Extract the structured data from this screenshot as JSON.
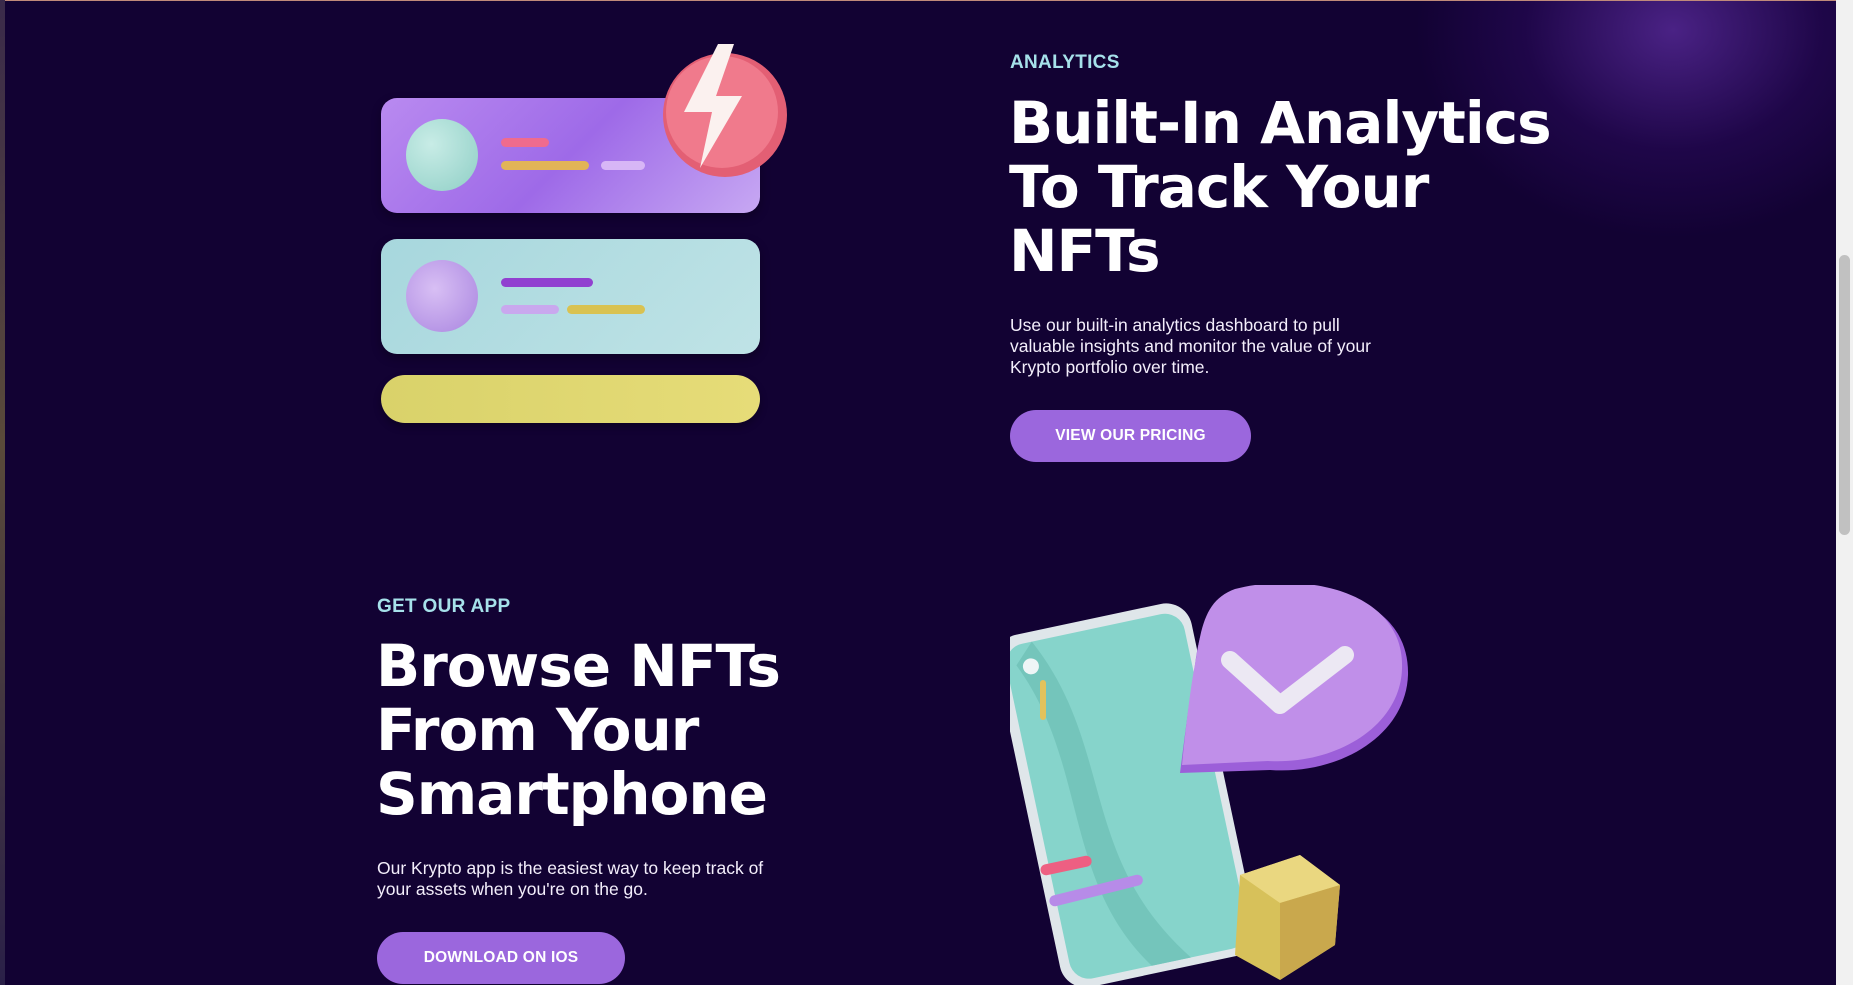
{
  "analytics": {
    "eyebrow": "ANALYTICS",
    "title_lines": [
      "Built-In Analytics",
      "To Track Your",
      "NFTs"
    ],
    "description_lines": [
      "Use our built-in analytics dashboard to pull",
      "valuable insights and monitor the value of your",
      "Krypto portfolio over time."
    ],
    "button_label": "VIEW OUR PRICING"
  },
  "app": {
    "eyebrow": "GET OUR APP",
    "title_lines": [
      "Browse NFTs",
      "From Your",
      "Smartphone"
    ],
    "description_lines": [
      "Our Krypto app is the easiest way to keep track of",
      "your assets when you're on the go."
    ],
    "button_label": "DOWNLOAD ON IOS"
  },
  "icons": {
    "analytics_illustration": "analytics-cards-with-lightning-badge",
    "app_illustration": "smartphone-with-check-bubble-and-cube"
  },
  "colors": {
    "background": "#120233",
    "eyebrow": "#a6e1ea",
    "button": "#9b67dd",
    "text": "#ffffff"
  }
}
